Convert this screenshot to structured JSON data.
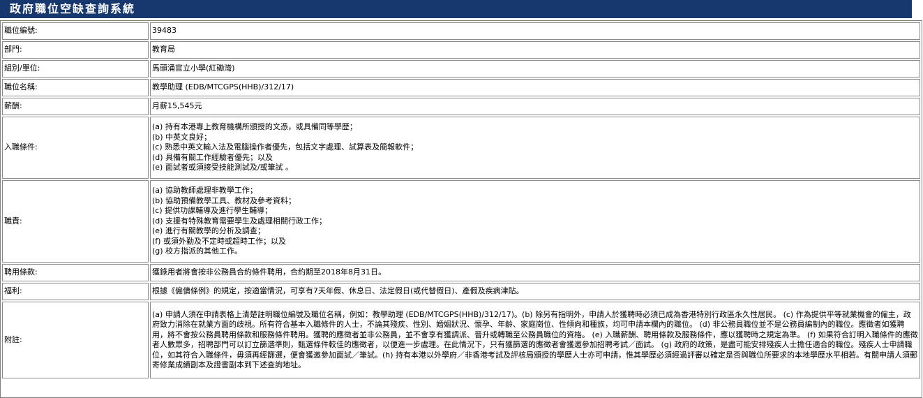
{
  "page": {
    "title": "政府職位空缺查詢系統"
  },
  "rows": [
    {
      "label": "職位編號:",
      "value": "39483"
    },
    {
      "label": "部門:",
      "value": "教育局"
    },
    {
      "label": "組別/單位:",
      "value": "馬頭涌官立小學(紅磡灣)"
    },
    {
      "label": "職位名稱:",
      "value": "教學助理 (EDB/MTCGPS(HHB)/312/17)"
    },
    {
      "label": "薪酬:",
      "value": "月薪15,545元"
    },
    {
      "label": "入職條件:",
      "lines": [
        "(a) 持有本港專上教育機構所頒授的文憑，或具備同等學歷；",
        "(b) 中英文良好；",
        "(c) 熟悉中英文輸入法及電腦操作者優先，包括文字處理、試算表及簡報軟件；",
        "(d) 具備有關工作經驗者優先；以及",
        "(e) 面試者或須接受技能測試及/或筆試 。"
      ]
    },
    {
      "label": "職責:",
      "lines": [
        "(a) 協助教師處理非教學工作；",
        "(b) 協助預備教學工具、教材及參考資料；",
        "(c) 提供功課輔導及進行學生輔導；",
        "(d) 支援有特殊教育需要學生及處理相關行政工作；",
        "(e) 進行有關教學的分析及調查；",
        "(f) 或須外勤及不定時或超時工作；以及",
        "(g) 校方指派的其他工作。"
      ]
    },
    {
      "label": "聘用條款:",
      "value": "獲錄用者將會按非公務員合約條件聘用，合約期至2018年8月31日。"
    },
    {
      "label": "福利:",
      "value": "根據《僱傭條例》的規定，按適當情況，可享有7天年假、休息日、法定假日(或代替假日)、產假及疾病津貼。"
    },
    {
      "label": "附註:",
      "value": "(a) 申請人須在申請表格上清楚註明職位編號及職位名稱，例如：教學助理 (EDB/MTCGPS(HHB)/312/17)。(b) 除另有指明外，申請人於獲聘時必須已成為香港特別行政區永久性居民。 (c) 作為提供平等就業機會的僱主，政府致力消除在就業方面的歧視。所有符合基本入職條件的人士，不論其殘疾、性別、婚姻狀況、懷孕、年齡、家庭崗位、性傾向和種族，均可申請本欄內的職位。 (d) 非公務員職位並不是公務員編制內的職位。應徵者如獲聘用，將不會按公務員聘用條款和服務條件聘用。獲聘的應徵者並非公務員，並不會享有獲調派、晉升或轉職至公務員職位的資格。 (e) 入職薪酬、聘用條款及服務條件，應以獲聘時之規定為準。 (f) 如果符合訂明入職條件的應徵者人數眾多，招聘部門可以訂立篩選準則，甄選條件較佳的應徵者，以便進一步處理。在此情況下，只有獲篩選的應徵者會獲邀參加招聘考試／面試。 (g) 政府的政策，是盡可能安排殘疾人士擔任適合的職位。殘疾人士申請職位，如其符合入職條件，毋須再經篩選，便會獲邀參加面試／筆試。(h) 持有本港以外學府／非香港考試及評核局頒授的學歷人士亦可申請，惟其學歷必須經過評審以確定是否與職位所要求的本地學歷水平相若。有關申請人須郵寄修業成績副本及證書副本到下述查詢地址。"
    }
  ]
}
